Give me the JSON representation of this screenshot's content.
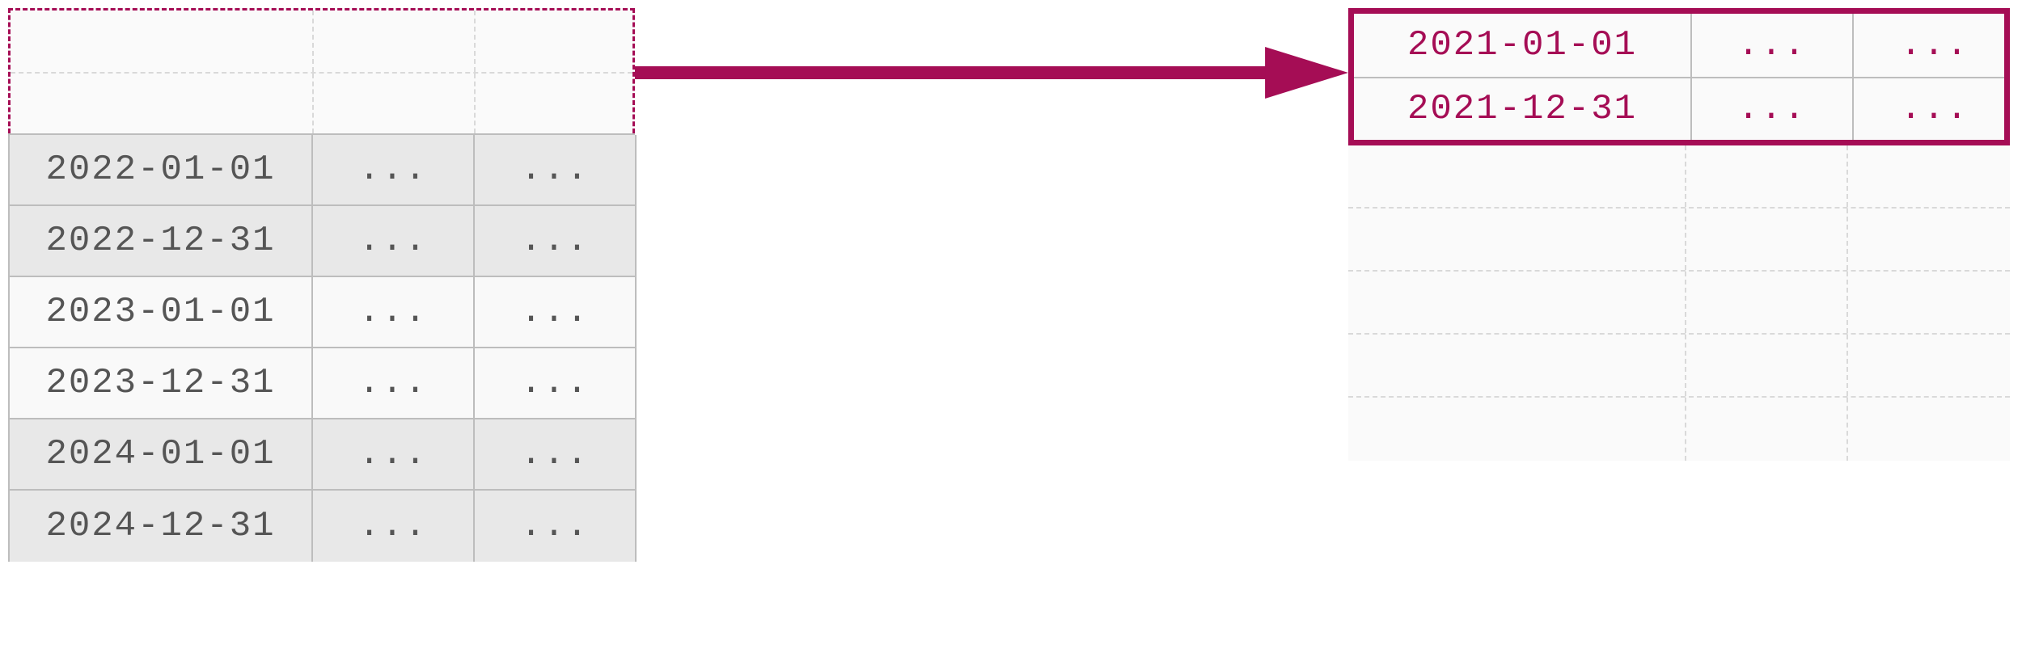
{
  "ellipsis": "...",
  "colors": {
    "accent": "#a50d55",
    "cell_border": "#bdbdbd",
    "dashed_border": "#d9d9d9",
    "shaded_row_bg": "#e8e8e8",
    "plain_row_bg": "#f9f9f9"
  },
  "left_table": {
    "dashed_placeholder_rows": 2,
    "rows": [
      {
        "date": "2022-01-01",
        "col2": "...",
        "col3": "...",
        "shaded": true
      },
      {
        "date": "2022-12-31",
        "col2": "...",
        "col3": "...",
        "shaded": true
      },
      {
        "date": "2023-01-01",
        "col2": "...",
        "col3": "...",
        "shaded": false
      },
      {
        "date": "2023-12-31",
        "col2": "...",
        "col3": "...",
        "shaded": false
      },
      {
        "date": "2024-01-01",
        "col2": "...",
        "col3": "...",
        "shaded": true
      },
      {
        "date": "2024-12-31",
        "col2": "...",
        "col3": "...",
        "shaded": true
      }
    ]
  },
  "right_table": {
    "rows": [
      {
        "date": "2021-01-01",
        "col2": "...",
        "col3": "..."
      },
      {
        "date": "2021-12-31",
        "col2": "...",
        "col3": "..."
      }
    ],
    "dashed_placeholder_rows": 5
  }
}
